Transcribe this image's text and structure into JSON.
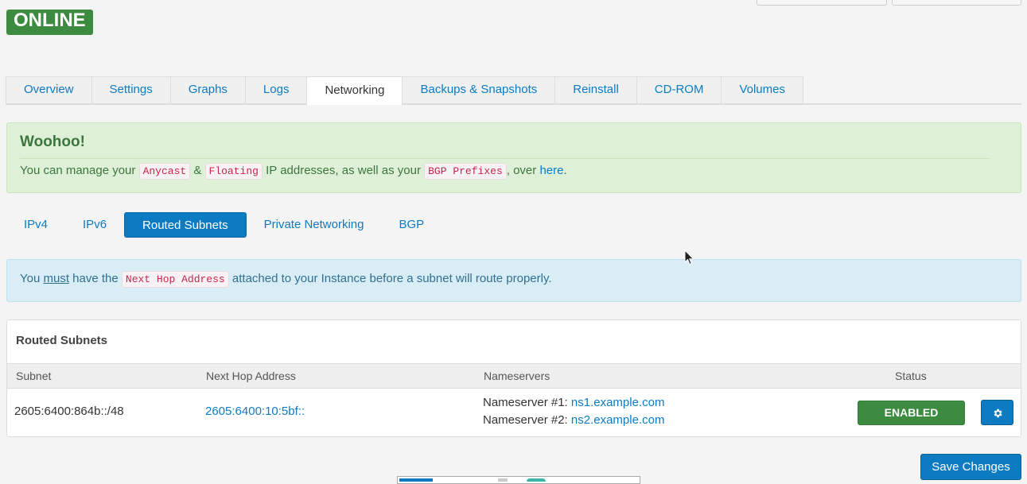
{
  "server": {
    "status": "ONLINE"
  },
  "tabs": [
    {
      "label": "Overview"
    },
    {
      "label": "Settings"
    },
    {
      "label": "Graphs"
    },
    {
      "label": "Logs"
    },
    {
      "label": "Networking",
      "active": true
    },
    {
      "label": "Backups & Snapshots"
    },
    {
      "label": "Reinstall"
    },
    {
      "label": "CD-ROM"
    },
    {
      "label": "Volumes"
    }
  ],
  "success_alert": {
    "heading": "Woohoo!",
    "text_1": "You can manage your",
    "code_anycast": "Anycast",
    "text_2": "&",
    "code_floating": "Floating",
    "text_3": "IP addresses, as well as your",
    "code_bgp": "BGP Prefixes",
    "text_4": ", over",
    "link": "here",
    "text_5": "."
  },
  "subtabs": [
    {
      "label": "IPv4"
    },
    {
      "label": "IPv6"
    },
    {
      "label": "Routed Subnets",
      "active": true
    },
    {
      "label": "Private Networking"
    },
    {
      "label": "BGP"
    }
  ],
  "info_alert": {
    "text_1": "You",
    "emphasis": "must",
    "text_2": "have the",
    "code": "Next Hop Address",
    "text_3": "attached to your Instance before a subnet will route properly."
  },
  "routed_subnets": {
    "title": "Routed Subnets",
    "columns": {
      "subnet": "Subnet",
      "next_hop": "Next Hop Address",
      "nameservers": "Nameservers",
      "status": "Status"
    },
    "row": {
      "subnet": "2605:6400:864b::/48",
      "next_hop": "2605:6400:10:5bf::",
      "ns1_label": "Nameserver #1:",
      "ns1": "ns1.example.com",
      "ns2_label": "Nameserver #2:",
      "ns2": "ns2.example.com",
      "status": "ENABLED",
      "settings_icon": "gear-icon"
    }
  },
  "footer": {
    "save_label": "Save Changes"
  },
  "colors": {
    "primary": "#0c7bc2",
    "success": "#3d8b40",
    "success_alert_bg": "#dff0d8",
    "info_alert_bg": "#d9edf7",
    "code_text": "#c7254e"
  }
}
